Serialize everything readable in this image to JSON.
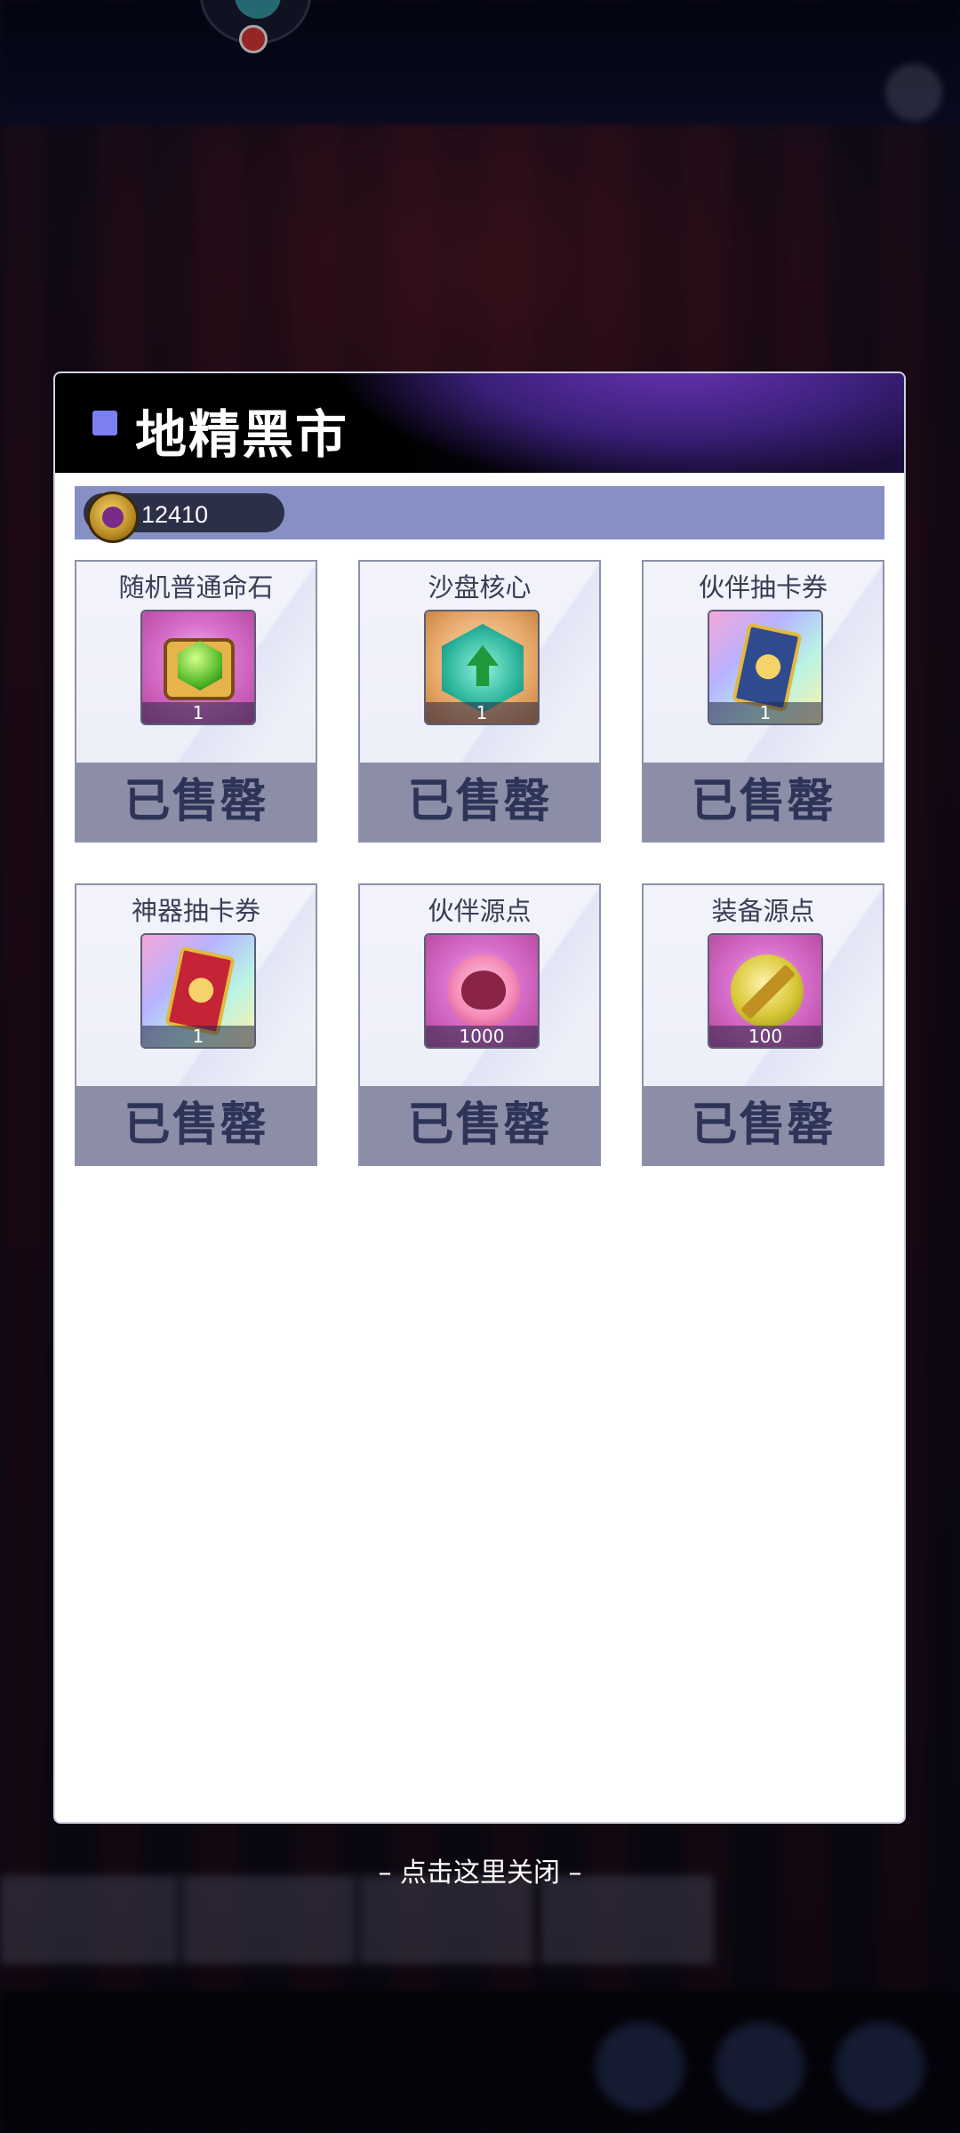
{
  "background": {
    "top_banner_text": "",
    "tab_labels": []
  },
  "panel": {
    "title": "地精黑市",
    "currency": {
      "icon": "gold-coin-icon",
      "value": "12410"
    },
    "items": [
      {
        "name": "随机普通命石",
        "quantity": "1",
        "status": "已售罄",
        "icon": "green-gem-icon"
      },
      {
        "name": "沙盘核心",
        "quantity": "1",
        "status": "已售罄",
        "icon": "sandbox-core-icon"
      },
      {
        "name": "伙伴抽卡券",
        "quantity": "1",
        "status": "已售罄",
        "icon": "partner-ticket-icon"
      },
      {
        "name": "神器抽卡券",
        "quantity": "1",
        "status": "已售罄",
        "icon": "artifact-ticket-icon"
      },
      {
        "name": "伙伴源点",
        "quantity": "1000",
        "status": "已售罄",
        "icon": "partner-origin-icon"
      },
      {
        "name": "装备源点",
        "quantity": "100",
        "status": "已售罄",
        "icon": "equipment-origin-icon"
      }
    ]
  },
  "close_hint": "– 点击这里关闭 –",
  "colors": {
    "header_accent": "#7b7ff2",
    "currency_bar": "#8690c4",
    "soldout_bar": "#8b8ea6",
    "soldout_text": "#2e3358"
  }
}
